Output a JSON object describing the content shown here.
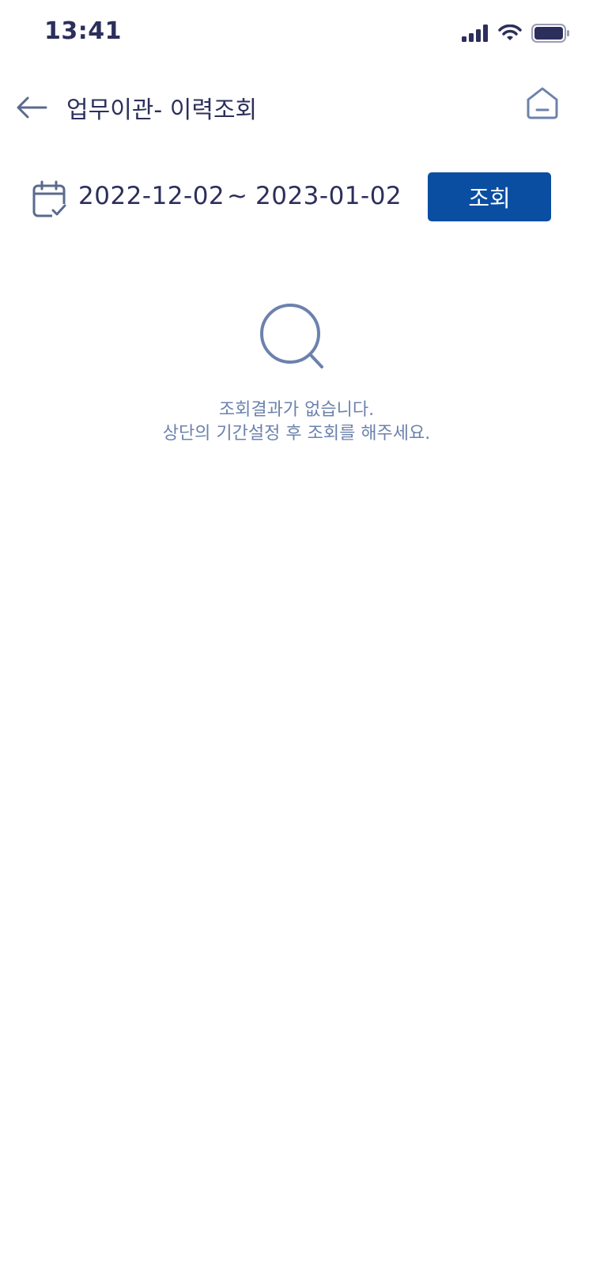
{
  "status_bar": {
    "time": "13:41"
  },
  "header": {
    "title": "업무이관- 이력조회"
  },
  "filter": {
    "date_from": "2022-12-02",
    "separator": "~",
    "date_to": "2023-01-02",
    "search_label": "조회"
  },
  "empty_state": {
    "line1": "조회결과가 없습니다.",
    "line2": "상단의 기간설정 후 조회를 해주세요."
  },
  "colors": {
    "primary": "#0a4ea2",
    "text": "#2c2f5b",
    "muted": "#6c82ad"
  },
  "icons": [
    "signal-icon",
    "wifi-icon",
    "battery-icon",
    "back-arrow-icon",
    "home-icon",
    "calendar-check-icon",
    "search-icon"
  ]
}
